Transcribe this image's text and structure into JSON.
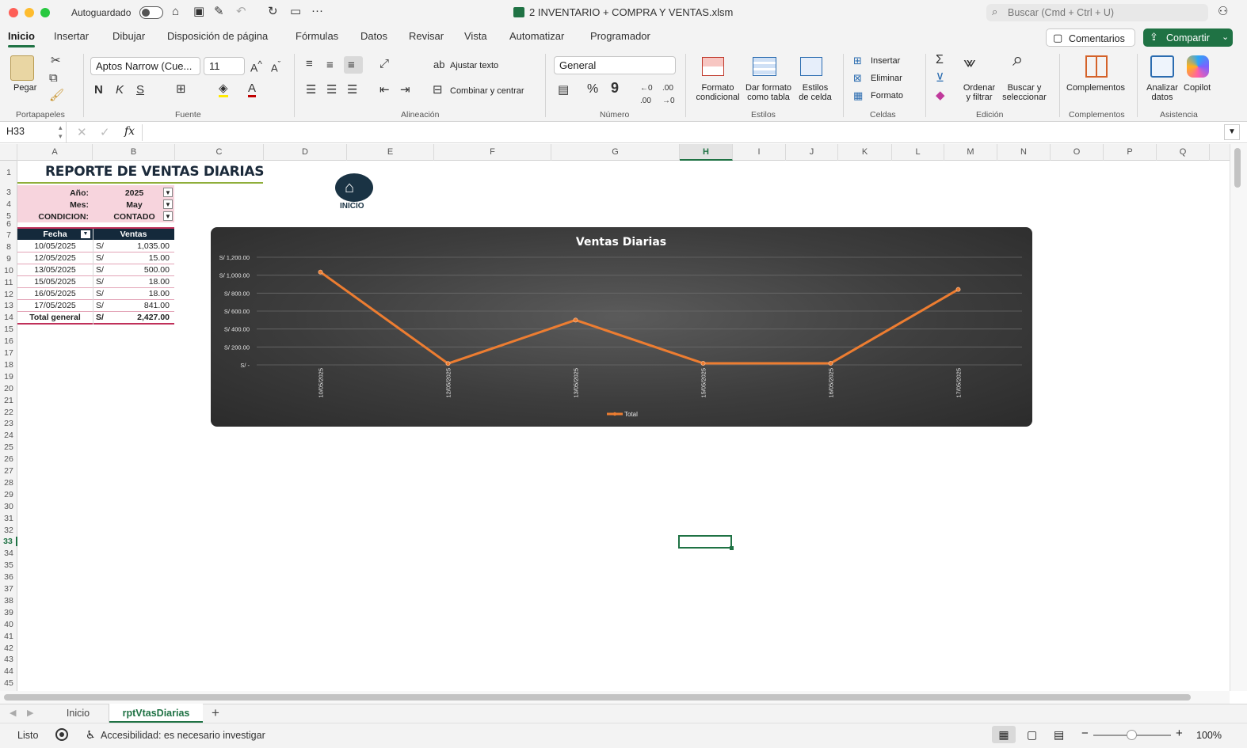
{
  "window": {
    "autosave_label": "Autoguardado",
    "doc_title": "2 INVENTARIO + COMPRA Y VENTAS.xlsm",
    "search_placeholder": "Buscar (Cmd + Ctrl + U)"
  },
  "tabs": [
    "Inicio",
    "Insertar",
    "Dibujar",
    "Disposición de página",
    "Fórmulas",
    "Datos",
    "Revisar",
    "Vista",
    "Automatizar",
    "Programador"
  ],
  "buttons": {
    "comments": "Comentarios",
    "share": "Compartir"
  },
  "ribbon": {
    "paste": "Pegar",
    "font_name": "Aptos Narrow (Cue...",
    "font_size": "11",
    "wrap_text": "Ajustar texto",
    "merge_center": "Combinar y centrar",
    "number_format": "General",
    "cond_format_1": "Formato",
    "cond_format_2": "condicional",
    "table_format_1": "Dar formato",
    "table_format_2": "como tabla",
    "cell_styles_1": "Estilos",
    "cell_styles_2": "de celda",
    "insert": "Insertar",
    "delete": "Eliminar",
    "format": "Formato",
    "sort_1": "Ordenar",
    "sort_2": "y filtrar",
    "find_1": "Buscar y",
    "find_2": "seleccionar",
    "addins": "Complementos",
    "analyze_1": "Analizar",
    "analyze_2": "datos",
    "copilot": "Copilot",
    "groups": {
      "clipboard": "Portapapeles",
      "font": "Fuente",
      "alignment": "Alineación",
      "number": "Número",
      "styles": "Estilos",
      "cells": "Celdas",
      "editing": "Edición",
      "addins": "Complementos",
      "assist": "Asistencia"
    }
  },
  "formula_bar": {
    "name_box": "H33",
    "fx": "fx"
  },
  "columns": [
    "A",
    "B",
    "C",
    "D",
    "E",
    "F",
    "G",
    "H",
    "I",
    "J",
    "K",
    "L",
    "M",
    "N",
    "O",
    "P",
    "Q"
  ],
  "rows": [
    "1",
    "3",
    "4",
    "5",
    "6",
    "7",
    "8",
    "9",
    "10",
    "11",
    "12",
    "13",
    "14",
    "15",
    "16",
    "17",
    "18",
    "19",
    "20",
    "21",
    "22",
    "23",
    "24",
    "25",
    "26",
    "27",
    "28",
    "29",
    "30",
    "31",
    "32",
    "33",
    "34",
    "35",
    "36",
    "37",
    "38",
    "39",
    "40",
    "41",
    "42",
    "43",
    "44",
    "45"
  ],
  "report": {
    "title": "REPORTE DE VENTAS DIARIAS",
    "filters": [
      {
        "label": "Año:",
        "value": "2025"
      },
      {
        "label": "Mes:",
        "value": "May"
      },
      {
        "label": "CONDICION:",
        "value": "CONTADO"
      }
    ],
    "table_headers": [
      "Fecha",
      "Ventas"
    ],
    "rows": [
      {
        "fecha": "10/05/2025",
        "cur": "S/",
        "ventas": "1,035.00"
      },
      {
        "fecha": "12/05/2025",
        "cur": "S/",
        "ventas": "15.00"
      },
      {
        "fecha": "13/05/2025",
        "cur": "S/",
        "ventas": "500.00"
      },
      {
        "fecha": "15/05/2025",
        "cur": "S/",
        "ventas": "18.00"
      },
      {
        "fecha": "16/05/2025",
        "cur": "S/",
        "ventas": "18.00"
      },
      {
        "fecha": "17/05/2025",
        "cur": "S/",
        "ventas": "841.00"
      }
    ],
    "total": {
      "label": "Total general",
      "cur": "S/",
      "value": "2,427.00"
    },
    "home_button": "INICIO"
  },
  "chart_data": {
    "type": "line",
    "title": "Ventas Diarias",
    "categories": [
      "10/05/2025",
      "12/05/2025",
      "13/05/2025",
      "15/05/2025",
      "16/05/2025",
      "17/05/2025"
    ],
    "series": [
      {
        "name": "Total",
        "values": [
          1035,
          15,
          500,
          18,
          18,
          841
        ]
      }
    ],
    "ylim": [
      0,
      1200
    ],
    "yticks": [
      {
        "v": 1200,
        "label": "S/ 1,200.00"
      },
      {
        "v": 1000,
        "label": "S/ 1,000.00"
      },
      {
        "v": 800,
        "label": "S/ 800.00"
      },
      {
        "v": 600,
        "label": "S/ 600.00"
      },
      {
        "v": 400,
        "label": "S/ 400.00"
      },
      {
        "v": 200,
        "label": "S/ 200.00"
      },
      {
        "v": 0,
        "label": "S/ -"
      }
    ],
    "grid": true,
    "legend": "bottom",
    "color": "#ed7d31"
  },
  "sheets": [
    "Inicio",
    "rptVtasDiarias"
  ],
  "status": {
    "ready": "Listo",
    "accessibility": "Accesibilidad: es necesario investigar",
    "zoom": "100%"
  }
}
